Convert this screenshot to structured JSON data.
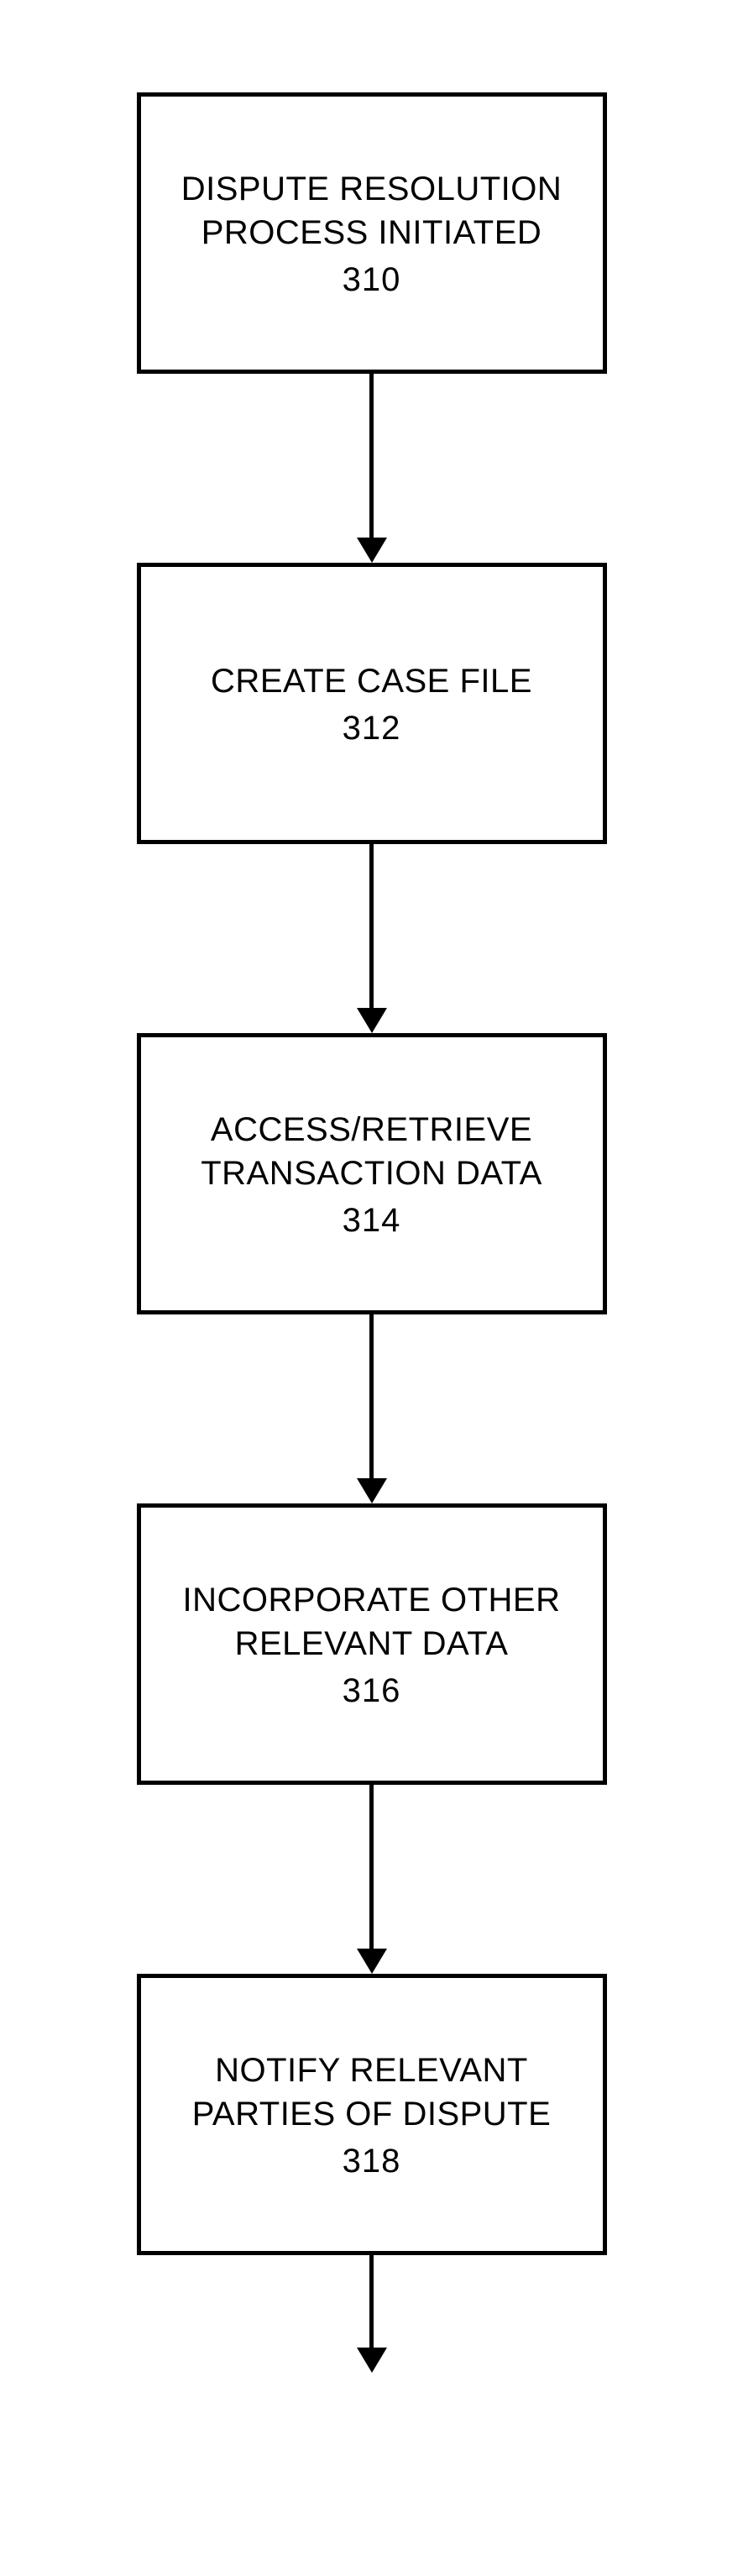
{
  "chart_data": {
    "type": "flowchart",
    "direction": "vertical",
    "nodes": [
      {
        "id": "310",
        "label": "DISPUTE RESOLUTION PROCESS INITIATED",
        "ref": "310"
      },
      {
        "id": "312",
        "label": "CREATE CASE FILE",
        "ref": "312"
      },
      {
        "id": "314",
        "label": "ACCESS/RETRIEVE TRANSACTION DATA",
        "ref": "314"
      },
      {
        "id": "316",
        "label": "INCORPORATE OTHER RELEVANT DATA",
        "ref": "316"
      },
      {
        "id": "318",
        "label": "NOTIFY RELEVANT PARTIES OF DISPUTE",
        "ref": "318"
      }
    ],
    "edges": [
      {
        "from": "310",
        "to": "312"
      },
      {
        "from": "312",
        "to": "314"
      },
      {
        "from": "314",
        "to": "316"
      },
      {
        "from": "316",
        "to": "318"
      },
      {
        "from": "318",
        "to": "continue"
      }
    ]
  },
  "steps": {
    "s0": {
      "title": "DISPUTE RESOLUTION PROCESS INITIATED",
      "num": "310"
    },
    "s1": {
      "title": "CREATE CASE FILE",
      "num": "312"
    },
    "s2": {
      "title": "ACCESS/RETRIEVE TRANSACTION DATA",
      "num": "314"
    },
    "s3": {
      "title": "INCORPORATE OTHER RELEVANT DATA",
      "num": "316"
    },
    "s4": {
      "title": "NOTIFY RELEVANT PARTIES OF DISPUTE",
      "num": "318"
    }
  }
}
